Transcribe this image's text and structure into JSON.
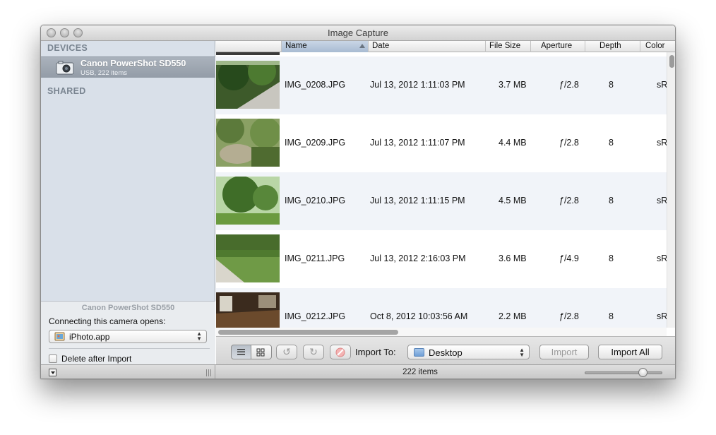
{
  "window": {
    "title": "Image Capture"
  },
  "sidebar": {
    "devices_header": "DEVICES",
    "device": {
      "name": "Canon PowerShot SD550",
      "subtitle": "USB, 222 items"
    },
    "shared_header": "SHARED",
    "panel": {
      "title": "Canon PowerShot SD550",
      "opens_label": "Connecting this camera opens:",
      "app_selected": "iPhoto.app",
      "delete_after_import_label": "Delete after Import",
      "delete_after_import_checked": false
    }
  },
  "columns": [
    "Name",
    "Date",
    "File Size",
    "Aperture",
    "Depth",
    "Color"
  ],
  "rows": [
    {
      "name": "IMG_0208.JPG",
      "date": "Jul 13, 2012 1:11:03 PM",
      "size": "3.7 MB",
      "aperture": "ƒ/2.8",
      "depth": "8",
      "color": "sR"
    },
    {
      "name": "IMG_0209.JPG",
      "date": "Jul 13, 2012 1:11:07 PM",
      "size": "4.4 MB",
      "aperture": "ƒ/2.8",
      "depth": "8",
      "color": "sR"
    },
    {
      "name": "IMG_0210.JPG",
      "date": "Jul 13, 2012 1:11:15 PM",
      "size": "4.5 MB",
      "aperture": "ƒ/2.8",
      "depth": "8",
      "color": "sR"
    },
    {
      "name": "IMG_0211.JPG",
      "date": "Jul 13, 2012 2:16:03 PM",
      "size": "3.6 MB",
      "aperture": "ƒ/4.9",
      "depth": "8",
      "color": "sR"
    },
    {
      "name": "IMG_0212.JPG",
      "date": "Oct 8, 2012 10:03:56 AM",
      "size": "2.2 MB",
      "aperture": "ƒ/2.8",
      "depth": "8",
      "color": "sR"
    }
  ],
  "toolbar": {
    "import_to_label": "Import To:",
    "destination": "Desktop",
    "import_label": "Import",
    "import_all_label": "Import All"
  },
  "status": {
    "item_count": "222 items"
  },
  "icons": {
    "list_view": "list-view-icon",
    "grid_view": "grid-view-icon",
    "rotate_left": "rotate-left-icon",
    "rotate_right": "rotate-right-icon",
    "delete": "delete-icon"
  }
}
